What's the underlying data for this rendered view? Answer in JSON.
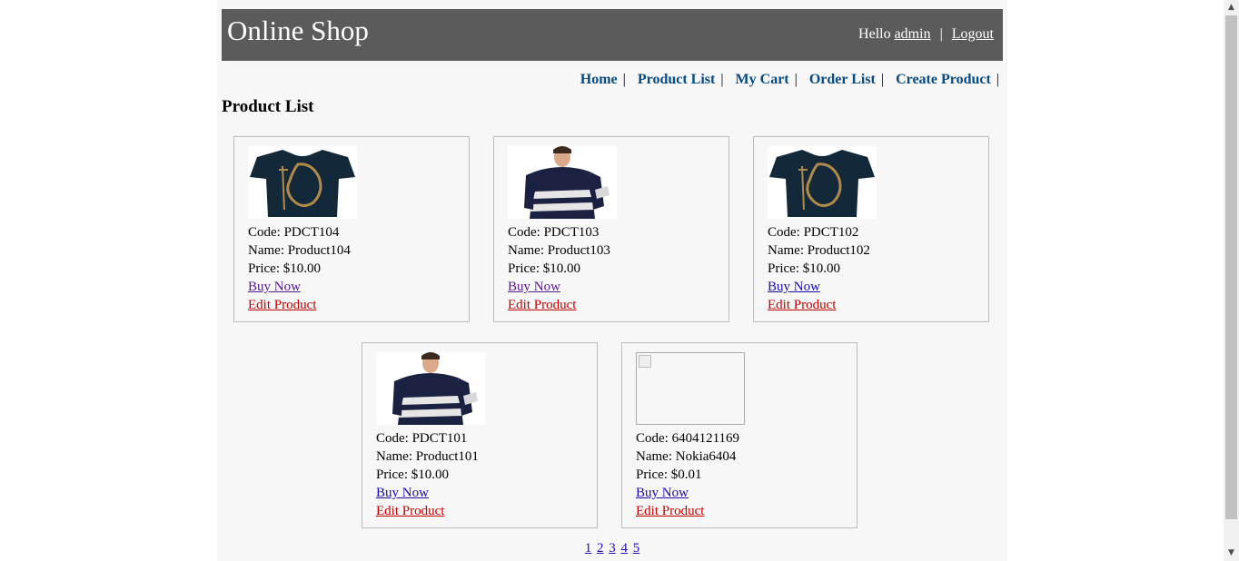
{
  "header": {
    "site_title": "Online Shop",
    "greeting": "Hello",
    "username": "admin",
    "separator": "|",
    "logout": "Logout"
  },
  "menu": {
    "items": [
      {
        "label": "Home"
      },
      {
        "label": "Product List"
      },
      {
        "label": "My Cart"
      },
      {
        "label": "Order List"
      },
      {
        "label": "Create Product"
      }
    ],
    "separator": "|"
  },
  "page_title": "Product List",
  "products": [
    {
      "code": "Code: PDCT104",
      "name": "Name: Product104",
      "price": "Price: $10.00",
      "buy": "Buy Now",
      "edit": "Edit Product",
      "image": "navy-tshirt-gold-print"
    },
    {
      "code": "Code: PDCT103",
      "name": "Name: Product103",
      "price": "Price: $10.00",
      "buy": "Buy Now",
      "edit": "Edit Product",
      "image": "man-striped-sweater"
    },
    {
      "code": "Code: PDCT102",
      "name": "Name: Product102",
      "price": "Price: $10.00",
      "buy": "Buy Now",
      "edit": "Edit Product",
      "image": "navy-tshirt-gold-print"
    },
    {
      "code": "Code: PDCT101",
      "name": "Name: Product101",
      "price": "Price: $10.00",
      "buy": "Buy Now",
      "edit": "Edit Product",
      "image": "man-striped-sweater"
    },
    {
      "code": "Code: 6404121169",
      "name": "Name: Nokia6404",
      "price": "Price: $0.01",
      "buy": "Buy Now",
      "edit": "Edit Product",
      "image": "broken-image-icon"
    }
  ],
  "pagination": [
    "1",
    "2",
    "3",
    "4",
    "5"
  ],
  "colors": {
    "header_bg": "#5b5b5b",
    "menu_link": "#084a82",
    "buy_link": "#1a0dab",
    "edit_link": "#c00000",
    "page_bg": "#f7f7f7"
  }
}
